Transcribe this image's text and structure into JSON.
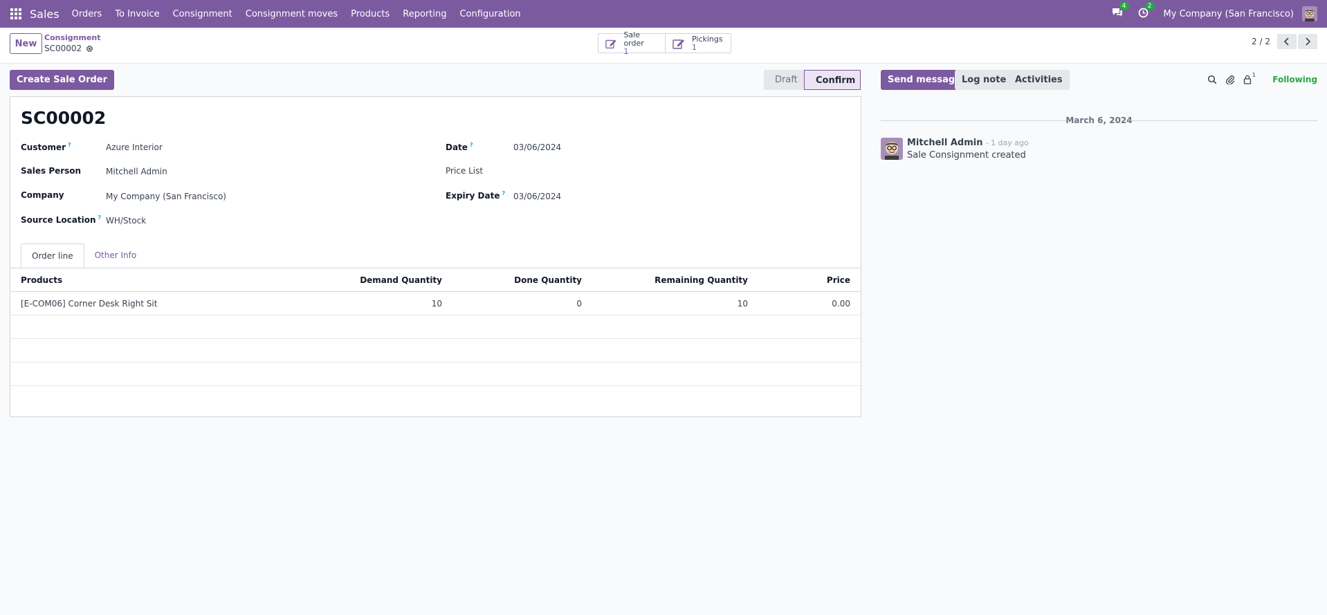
{
  "navbar": {
    "brand": "Sales",
    "menu": [
      "Orders",
      "To Invoice",
      "Consignment",
      "Consignment moves",
      "Products",
      "Reporting",
      "Configuration"
    ],
    "messages_count": "4",
    "activities_count": "2",
    "company": "My Company (San Francisco)"
  },
  "control": {
    "new_label": "New",
    "breadcrumb_parent": "Consignment",
    "breadcrumb_current": "SC00002",
    "smart_buttons": [
      {
        "label": "Sale order",
        "value": "1"
      },
      {
        "label": "Pickings",
        "value": "1"
      }
    ],
    "pager": "2 / 2"
  },
  "form": {
    "action_button": "Create Sale Order",
    "statusbar": [
      "Draft",
      "Confirm"
    ],
    "title": "SC00002",
    "left_fields": [
      {
        "label": "Customer",
        "help": "?",
        "value": "Azure Interior"
      },
      {
        "label": "Sales Person",
        "help": "",
        "value": "Mitchell Admin"
      },
      {
        "label": "Company",
        "help": "",
        "value": "My Company (San Francisco)"
      },
      {
        "label": "Source Location",
        "help": "?",
        "value": "WH/Stock"
      }
    ],
    "right_fields": [
      {
        "label": "Date",
        "help": "?",
        "value": "03/06/2024"
      },
      {
        "label": "Price List",
        "help": "",
        "value": ""
      },
      {
        "label": "Expiry Date",
        "help": "?",
        "value": "03/06/2024"
      }
    ],
    "tabs": [
      "Order line",
      "Other Info"
    ],
    "table": {
      "headers": [
        "Products",
        "Demand Quantity",
        "Done Quantity",
        "Remaining Quantity",
        "Price"
      ],
      "rows": [
        [
          "[E-COM06] Corner Desk Right Sit",
          "10",
          "0",
          "10",
          "0.00"
        ]
      ]
    }
  },
  "chatter": {
    "send_message": "Send message",
    "log_note": "Log note",
    "activities": "Activities",
    "followers_count": "1",
    "following": "Following",
    "date": "March 6, 2024",
    "message": {
      "author": "Mitchell Admin",
      "date": "- 1 day ago",
      "body": "Sale Consignment created"
    }
  },
  "colors": {
    "brand": "#7c5aa0",
    "success": "#28a745"
  }
}
